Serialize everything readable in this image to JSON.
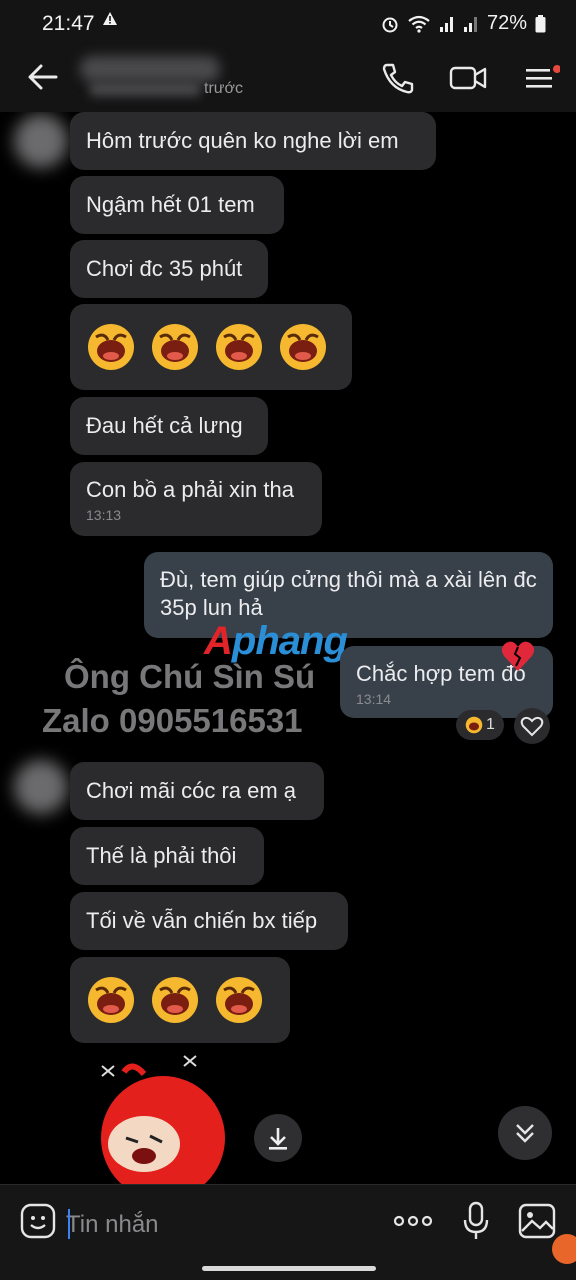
{
  "status_bar": {
    "time": "21:47",
    "battery": "72%"
  },
  "header": {
    "last_seen": "trước"
  },
  "messages": [
    {
      "text": "Hôm trước quên ko nghe lời em"
    },
    {
      "text": "Ngậm hết 01 tem"
    },
    {
      "text": "Chơi đc 35 phút"
    },
    {
      "text": "Đau hết cả lưng"
    },
    {
      "text": "Con bồ a phải xin tha",
      "time": "13:13"
    },
    {
      "text": "Đù, tem giúp cửng thôi mà a xài lên đc 35p lun hả"
    },
    {
      "text": "Chắc hợp tem đó",
      "time": "13:14"
    },
    {
      "text": "Chơi mãi cóc ra em ạ"
    },
    {
      "text": "Thế là phải thôi"
    },
    {
      "text": "Tối về vẫn chiến bx tiếp"
    }
  ],
  "reaction_count": "1",
  "watermark": {
    "logo_a": "A",
    "logo_rest": "phang",
    "line1": "Ông Chú Sìn Sú",
    "line2": "Zalo 0905516531"
  },
  "composer": {
    "placeholder": "Tin nhắn"
  },
  "colors": {
    "incoming_bubble": "#2b2b2d",
    "outgoing_bubble": "#38414a",
    "accent_red": "#e0242a",
    "accent_blue": "#2a8fd6"
  },
  "icons": [
    "warning-icon",
    "wifi-icon",
    "signal-icon",
    "battery-icon",
    "alarm-icon",
    "back-arrow-icon",
    "phone-icon",
    "video-call-icon",
    "menu-icon",
    "laughing-emoji-icon",
    "broken-heart-icon",
    "heart-icon",
    "download-icon",
    "chevron-double-down-icon",
    "sticker-icon",
    "more-icon",
    "microphone-icon",
    "image-icon"
  ]
}
